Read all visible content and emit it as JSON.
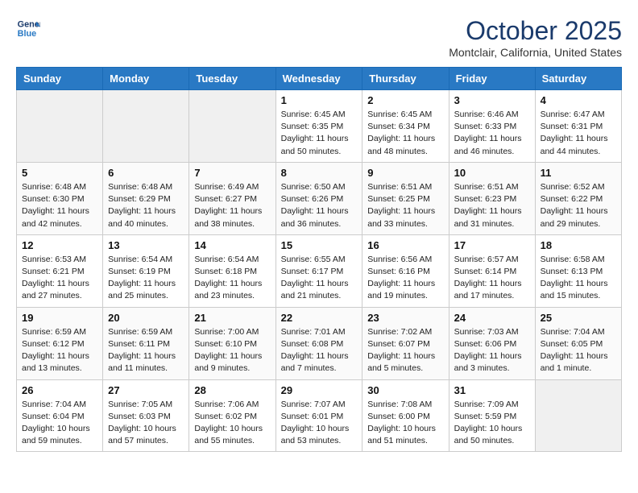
{
  "header": {
    "logo_line1": "General",
    "logo_line2": "Blue",
    "month": "October 2025",
    "location": "Montclair, California, United States"
  },
  "weekdays": [
    "Sunday",
    "Monday",
    "Tuesday",
    "Wednesday",
    "Thursday",
    "Friday",
    "Saturday"
  ],
  "weeks": [
    [
      {
        "day": "",
        "info": ""
      },
      {
        "day": "",
        "info": ""
      },
      {
        "day": "",
        "info": ""
      },
      {
        "day": "1",
        "info": "Sunrise: 6:45 AM\nSunset: 6:35 PM\nDaylight: 11 hours\nand 50 minutes."
      },
      {
        "day": "2",
        "info": "Sunrise: 6:45 AM\nSunset: 6:34 PM\nDaylight: 11 hours\nand 48 minutes."
      },
      {
        "day": "3",
        "info": "Sunrise: 6:46 AM\nSunset: 6:33 PM\nDaylight: 11 hours\nand 46 minutes."
      },
      {
        "day": "4",
        "info": "Sunrise: 6:47 AM\nSunset: 6:31 PM\nDaylight: 11 hours\nand 44 minutes."
      }
    ],
    [
      {
        "day": "5",
        "info": "Sunrise: 6:48 AM\nSunset: 6:30 PM\nDaylight: 11 hours\nand 42 minutes."
      },
      {
        "day": "6",
        "info": "Sunrise: 6:48 AM\nSunset: 6:29 PM\nDaylight: 11 hours\nand 40 minutes."
      },
      {
        "day": "7",
        "info": "Sunrise: 6:49 AM\nSunset: 6:27 PM\nDaylight: 11 hours\nand 38 minutes."
      },
      {
        "day": "8",
        "info": "Sunrise: 6:50 AM\nSunset: 6:26 PM\nDaylight: 11 hours\nand 36 minutes."
      },
      {
        "day": "9",
        "info": "Sunrise: 6:51 AM\nSunset: 6:25 PM\nDaylight: 11 hours\nand 33 minutes."
      },
      {
        "day": "10",
        "info": "Sunrise: 6:51 AM\nSunset: 6:23 PM\nDaylight: 11 hours\nand 31 minutes."
      },
      {
        "day": "11",
        "info": "Sunrise: 6:52 AM\nSunset: 6:22 PM\nDaylight: 11 hours\nand 29 minutes."
      }
    ],
    [
      {
        "day": "12",
        "info": "Sunrise: 6:53 AM\nSunset: 6:21 PM\nDaylight: 11 hours\nand 27 minutes."
      },
      {
        "day": "13",
        "info": "Sunrise: 6:54 AM\nSunset: 6:19 PM\nDaylight: 11 hours\nand 25 minutes."
      },
      {
        "day": "14",
        "info": "Sunrise: 6:54 AM\nSunset: 6:18 PM\nDaylight: 11 hours\nand 23 minutes."
      },
      {
        "day": "15",
        "info": "Sunrise: 6:55 AM\nSunset: 6:17 PM\nDaylight: 11 hours\nand 21 minutes."
      },
      {
        "day": "16",
        "info": "Sunrise: 6:56 AM\nSunset: 6:16 PM\nDaylight: 11 hours\nand 19 minutes."
      },
      {
        "day": "17",
        "info": "Sunrise: 6:57 AM\nSunset: 6:14 PM\nDaylight: 11 hours\nand 17 minutes."
      },
      {
        "day": "18",
        "info": "Sunrise: 6:58 AM\nSunset: 6:13 PM\nDaylight: 11 hours\nand 15 minutes."
      }
    ],
    [
      {
        "day": "19",
        "info": "Sunrise: 6:59 AM\nSunset: 6:12 PM\nDaylight: 11 hours\nand 13 minutes."
      },
      {
        "day": "20",
        "info": "Sunrise: 6:59 AM\nSunset: 6:11 PM\nDaylight: 11 hours\nand 11 minutes."
      },
      {
        "day": "21",
        "info": "Sunrise: 7:00 AM\nSunset: 6:10 PM\nDaylight: 11 hours\nand 9 minutes."
      },
      {
        "day": "22",
        "info": "Sunrise: 7:01 AM\nSunset: 6:08 PM\nDaylight: 11 hours\nand 7 minutes."
      },
      {
        "day": "23",
        "info": "Sunrise: 7:02 AM\nSunset: 6:07 PM\nDaylight: 11 hours\nand 5 minutes."
      },
      {
        "day": "24",
        "info": "Sunrise: 7:03 AM\nSunset: 6:06 PM\nDaylight: 11 hours\nand 3 minutes."
      },
      {
        "day": "25",
        "info": "Sunrise: 7:04 AM\nSunset: 6:05 PM\nDaylight: 11 hours\nand 1 minute."
      }
    ],
    [
      {
        "day": "26",
        "info": "Sunrise: 7:04 AM\nSunset: 6:04 PM\nDaylight: 10 hours\nand 59 minutes."
      },
      {
        "day": "27",
        "info": "Sunrise: 7:05 AM\nSunset: 6:03 PM\nDaylight: 10 hours\nand 57 minutes."
      },
      {
        "day": "28",
        "info": "Sunrise: 7:06 AM\nSunset: 6:02 PM\nDaylight: 10 hours\nand 55 minutes."
      },
      {
        "day": "29",
        "info": "Sunrise: 7:07 AM\nSunset: 6:01 PM\nDaylight: 10 hours\nand 53 minutes."
      },
      {
        "day": "30",
        "info": "Sunrise: 7:08 AM\nSunset: 6:00 PM\nDaylight: 10 hours\nand 51 minutes."
      },
      {
        "day": "31",
        "info": "Sunrise: 7:09 AM\nSunset: 5:59 PM\nDaylight: 10 hours\nand 50 minutes."
      },
      {
        "day": "",
        "info": ""
      }
    ]
  ]
}
